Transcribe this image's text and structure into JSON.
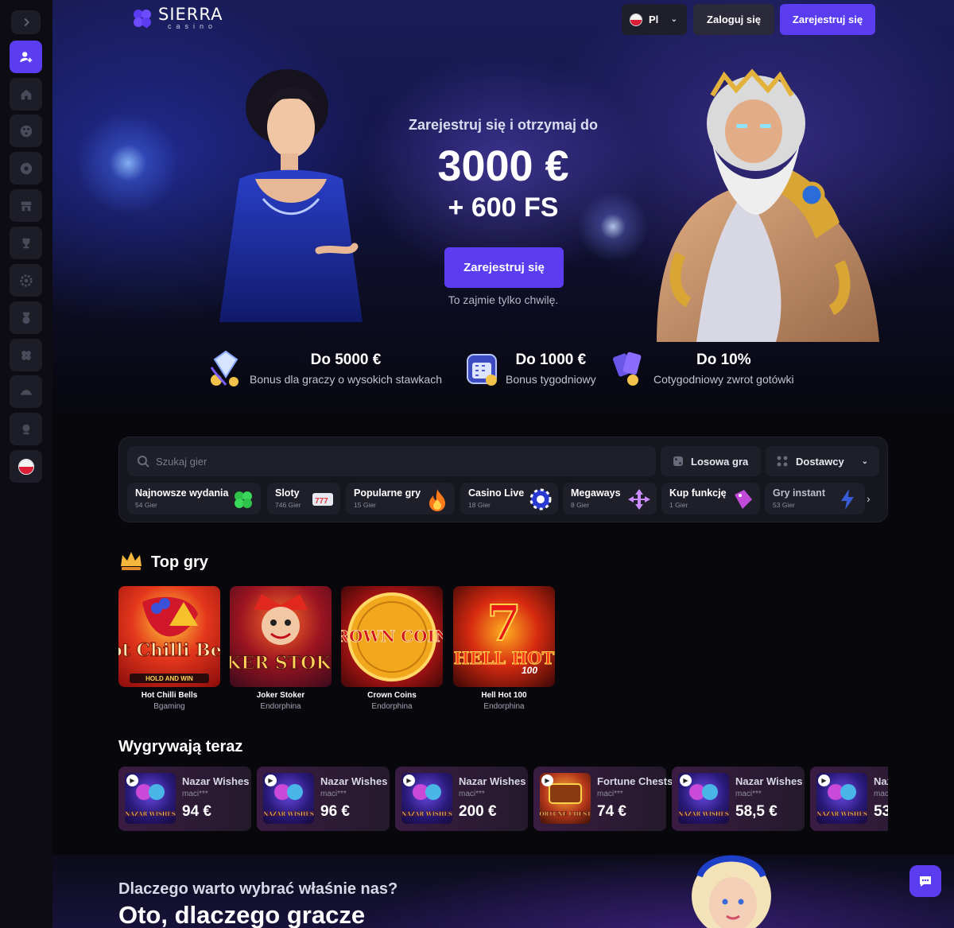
{
  "header": {
    "logo_main": "SIERRA",
    "logo_sub": "casino",
    "language": "Pl",
    "login_label": "Zaloguj się",
    "register_label": "Zarejestruj się"
  },
  "sidebar": {
    "items": [
      {
        "icon": "chevron-right-icon"
      },
      {
        "icon": "user-add-icon",
        "active": true
      },
      {
        "icon": "home-icon"
      },
      {
        "icon": "dice-icon"
      },
      {
        "icon": "roulette-icon"
      },
      {
        "icon": "store-icon"
      },
      {
        "icon": "trophy-icon"
      },
      {
        "icon": "settings-icon"
      },
      {
        "icon": "medal-icon"
      },
      {
        "icon": "clover-icon"
      },
      {
        "icon": "tournament-icon"
      },
      {
        "icon": "support-icon"
      },
      {
        "icon": "flag-pl-icon"
      }
    ]
  },
  "hero": {
    "subtitle": "Zarejestruj się i otrzymaj do",
    "amount": "3000 €",
    "free_spins": "+ 600 FS",
    "cta_label": "Zarejestruj się",
    "note": "To zajmie tylko chwilę."
  },
  "bonuses": [
    {
      "title": "Do 5000 €",
      "desc": "Bonus dla graczy o wysokich stawkach"
    },
    {
      "title": "Do 1000 €",
      "desc": "Bonus tygodniowy"
    },
    {
      "title": "Do 10%",
      "desc": "Cotygodniowy zwrot gotówki"
    }
  ],
  "search": {
    "placeholder": "Szukaj gier",
    "random_label": "Losowa gra",
    "providers_label": "Dostawcy"
  },
  "categories": [
    {
      "name": "Najnowsze wydania",
      "count": "54 Gier"
    },
    {
      "name": "Sloty",
      "count": "746 Gier"
    },
    {
      "name": "Popularne gry",
      "count": "15 Gier"
    },
    {
      "name": "Casino Live",
      "count": "18 Gier"
    },
    {
      "name": "Megaways",
      "count": "8 Gier"
    },
    {
      "name": "Kup funkcję",
      "count": "1 Gier"
    },
    {
      "name": "Gry instant",
      "count": "53 Gier"
    }
  ],
  "top_games": {
    "title": "Top gry",
    "items": [
      {
        "name": "Hot Chilli Bells",
        "provider": "Bgaming",
        "art": "Hot Chilli Bells",
        "art_tag": "HOLD AND WIN"
      },
      {
        "name": "Joker Stoker",
        "provider": "Endorphina",
        "art": "JOKER STOKER"
      },
      {
        "name": "Crown Coins",
        "provider": "Endorphina",
        "art": "CROWN COINS"
      },
      {
        "name": "Hell Hot 100",
        "provider": "Endorphina",
        "art": "HELL HOT",
        "art_tag": "100"
      }
    ]
  },
  "winners": {
    "title": "Wygrywają teraz",
    "items": [
      {
        "game": "Nazar Wishes",
        "user": "maci***",
        "amount": "94 €",
        "art": "NAZAR WISHES"
      },
      {
        "game": "Nazar Wishes",
        "user": "maci***",
        "amount": "96 €",
        "art": "NAZAR WISHES"
      },
      {
        "game": "Nazar Wishes",
        "user": "maci***",
        "amount": "200 €",
        "art": "NAZAR WISHES"
      },
      {
        "game": "Fortune Chests",
        "user": "maci***",
        "amount": "74 €",
        "art": "FORTUNE CHESTS"
      },
      {
        "game": "Nazar Wishes",
        "user": "maci***",
        "amount": "58,5 €",
        "art": "NAZAR WISHES"
      },
      {
        "game": "Nazar Wishes",
        "user": "maci***",
        "amount": "53",
        "art": "NAZAR WISHES"
      }
    ]
  },
  "why": {
    "subtitle": "Dlaczego warto wybrać właśnie nas?",
    "title": "Oto, dlaczego gracze"
  },
  "colors": {
    "accent": "#5b3cf0",
    "background": "#07070c",
    "panel": "#16161e"
  }
}
